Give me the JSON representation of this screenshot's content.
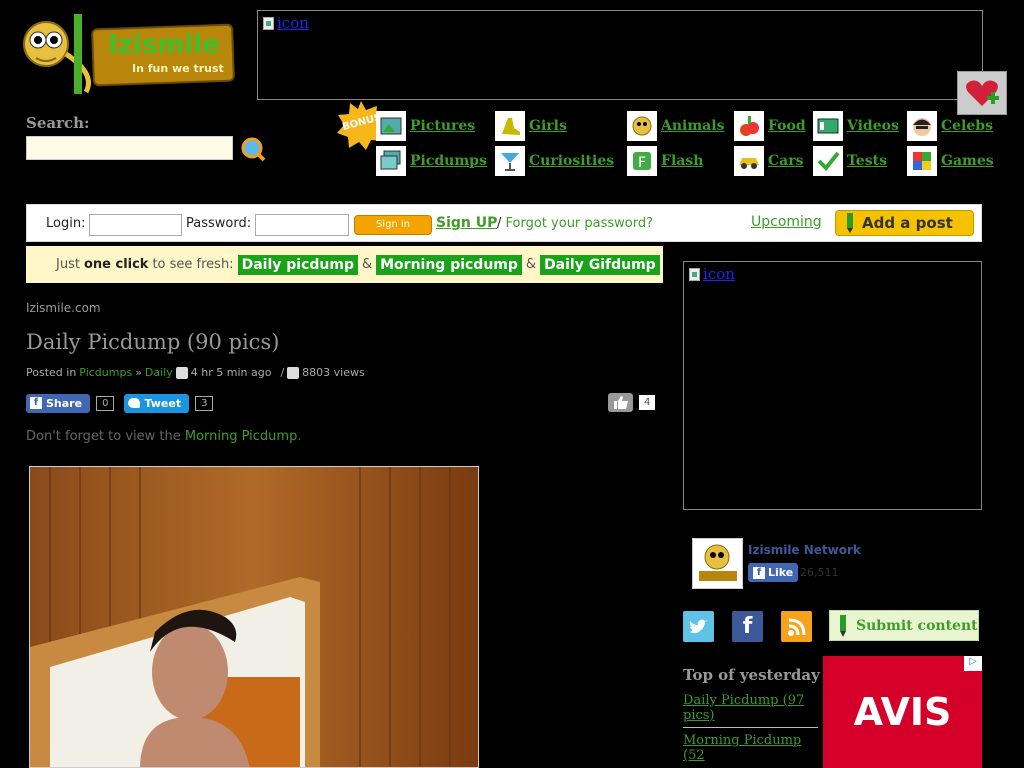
{
  "logo": {
    "title": "Izismile",
    "slogan": "In fun we trust"
  },
  "ad_top": {
    "link_text": "icon"
  },
  "search": {
    "label": "Search:",
    "placeholder": ""
  },
  "bonus_badge": "BONUS",
  "categories": [
    {
      "label": "Pictures",
      "icon": "pictures-icon"
    },
    {
      "label": "Girls",
      "icon": "girls-icon"
    },
    {
      "label": "Animals",
      "icon": "animals-icon"
    },
    {
      "label": "Food",
      "icon": "food-icon"
    },
    {
      "label": "Videos",
      "icon": "videos-icon"
    },
    {
      "label": "Celebs",
      "icon": "celebs-icon"
    },
    {
      "label": "Picdumps",
      "icon": "picdumps-icon"
    },
    {
      "label": "Curiosities",
      "icon": "curiosities-icon"
    },
    {
      "label": "Flash",
      "icon": "flash-icon"
    },
    {
      "label": "Cars",
      "icon": "cars-icon"
    },
    {
      "label": "Tests",
      "icon": "tests-icon"
    },
    {
      "label": "Games",
      "icon": "games-icon"
    }
  ],
  "login_bar": {
    "login_label": "Login:",
    "password_label": "Password:",
    "signin": "Sign in",
    "signup": "Sign UP",
    "separator": "/",
    "forgot": "Forgot your password?",
    "upcoming": "Upcoming",
    "add_post": "Add a post"
  },
  "fresh_bar": {
    "prefix": "Just",
    "bold": "one click",
    "suffix": "to see fresh:",
    "amp": "&",
    "links": [
      "Daily picdump",
      "Morning picdump",
      "Daily Gifdump"
    ]
  },
  "post": {
    "site": "Izismile.com",
    "title": "Daily Picdump (90 pics)",
    "posted_in": "Posted in",
    "category": "Picdumps",
    "arrow": "»",
    "subcategory": "Daily",
    "time": "4 hr 5 min ago",
    "slash": "/",
    "views": "8803 views",
    "share_label": "Share",
    "share_count": "0",
    "tweet_label": "Tweet",
    "tweet_count": "3",
    "like_count": "4",
    "reminder_prefix": "Don't forget to view the",
    "reminder_link": "Morning Picdump",
    "reminder_suffix": "."
  },
  "ad_right": {
    "link_text": "icon"
  },
  "network": {
    "name": "Izismile Network",
    "like": "Like",
    "count": "26,511"
  },
  "submit_content": "Submit content",
  "top_yesterday": {
    "heading": "Top of yesterday",
    "items": [
      "Daily Picdump (97 pics)",
      "Morning Picdump (52"
    ]
  },
  "avis_ad": {
    "brand": "AVIS",
    "adchoice": "▷"
  },
  "colors": {
    "accent_green": "#3c9d29",
    "button_green": "#1aa31a",
    "avis_red": "#d4002a"
  }
}
